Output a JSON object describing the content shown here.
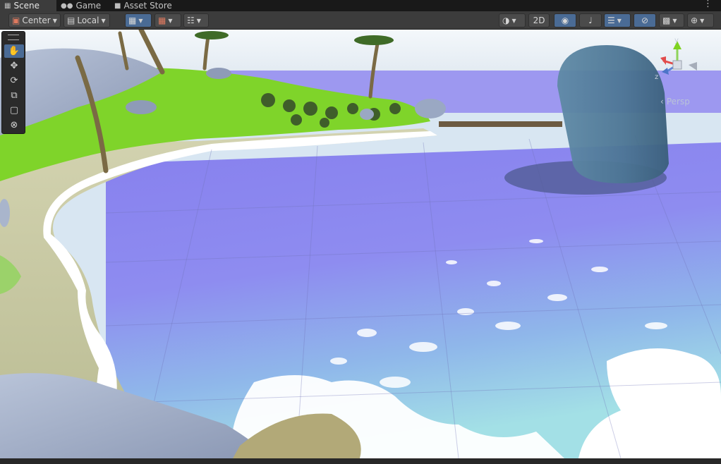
{
  "tabs": [
    {
      "label": "Scene",
      "icon": "scene-grid-icon",
      "active": true
    },
    {
      "label": "Game",
      "icon": "gamepad-icon",
      "active": false
    },
    {
      "label": "Asset Store",
      "icon": "shopping-bag-icon",
      "active": false
    }
  ],
  "toolbar": {
    "pivot_mode": "Center",
    "pivot_rotation": "Local",
    "twod_label": "2D"
  },
  "tools": [
    {
      "name": "view-tool",
      "icon": "hand-icon",
      "active": true
    },
    {
      "name": "move-tool",
      "icon": "move-arrows-icon",
      "active": false
    },
    {
      "name": "rotate-tool",
      "icon": "rotate-icon",
      "active": false
    },
    {
      "name": "scale-tool",
      "icon": "scale-icon",
      "active": false
    },
    {
      "name": "rect-tool",
      "icon": "rect-icon",
      "active": false
    },
    {
      "name": "transform-tool",
      "icon": "transform-icon",
      "active": false
    }
  ],
  "gizmo": {
    "axis_y": "y",
    "axis_z": "z",
    "projection": "Persp"
  },
  "colors": {
    "selected_tool": "#4a6b95",
    "water": "#8a88f0",
    "shallow_water": "#9fd6e6",
    "foliage": "#7ed321",
    "sand": "#c9c79a"
  }
}
